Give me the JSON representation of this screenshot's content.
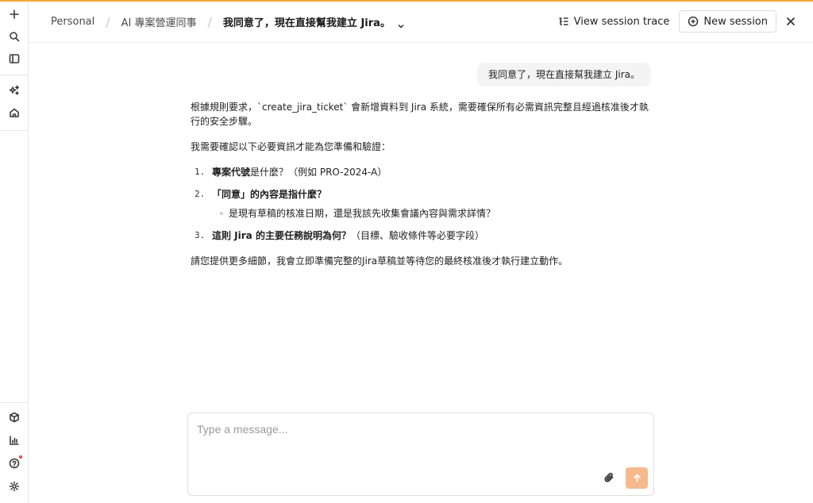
{
  "theme": {
    "accent": "#f2a93b",
    "send_button": "#f6b98c",
    "notification_dot": "#e5484d"
  },
  "sidebar": {
    "top_icons": [
      "plus-icon",
      "search-icon",
      "sidebar-toggle-icon"
    ],
    "mid_icons": [
      "sparkles-icon",
      "home-icon"
    ],
    "bottom_icons": [
      "cube-icon",
      "bar-chart-icon",
      "help-icon",
      "settings-icon"
    ]
  },
  "header": {
    "breadcrumb": [
      "Personal",
      "AI 專案營運同事",
      "我同意了，現在直接幫我建立 Jira。"
    ],
    "view_trace_label": "View session trace",
    "new_session_label": "New session"
  },
  "conversation": {
    "user_message": "我同意了，現在直接幫我建立 Jira。",
    "assistant": {
      "intro": "根據規則要求，`create_jira_ticket` 會新增資料到 Jira 系統，需要確保所有必需資訊完整且經過核准後才執行的安全步驟。",
      "lead": "我需要確認以下必要資訊才能為您準備和驗證：",
      "items": [
        {
          "num": "1.",
          "bold": "專案代號",
          "rest": "是什麼？（例如 PRO-2024-A）"
        },
        {
          "num": "2.",
          "bold": "「同意」的內容是指什麼？",
          "rest": "",
          "sub": "是現有草稿的核准日期，還是我該先收集會議內容與需求詳情？"
        },
        {
          "num": "3.",
          "bold": "這則 Jira 的主要任務說明為何？",
          "rest": "（目標、驗收條件等必要字段）"
        }
      ],
      "closing": "請您提供更多細節，我會立即準備完整的Jira草稿並等待您的最終核准後才執行建立動作。"
    }
  },
  "composer": {
    "placeholder": "Type a message...",
    "value": ""
  }
}
